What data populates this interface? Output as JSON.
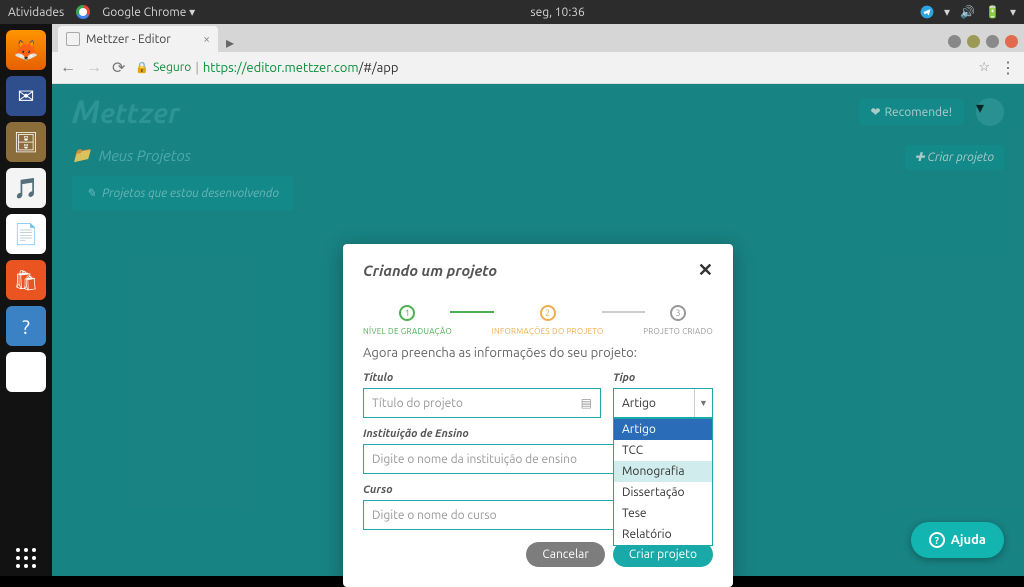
{
  "os_bar": {
    "activities": "Atividades",
    "app_menu": "Google Chrome ▾",
    "clock": "seg, 10:36"
  },
  "browser": {
    "tab_title": "Mettzer - Editor",
    "secure_label": "Seguro",
    "url_host": "https://editor.mettzer.com",
    "url_path": "/#/app"
  },
  "app": {
    "brand": "Mettzer",
    "recommend": "Recomende!",
    "breadcrumb": "Meus Projetos",
    "create_btn": "Criar projeto",
    "sub_tab": "Projetos que estou desenvolvendo",
    "help": "Ajuda"
  },
  "modal": {
    "title": "Criando um projeto",
    "steps": {
      "s1": "NÍVEL DE GRADUAÇÃO",
      "s2": "INFORMAÇÕES DO PROJETO",
      "s3": "PROJETO CRIADO"
    },
    "instruction": "Agora preencha as informações do seu projeto:",
    "fields": {
      "titulo_label": "Título",
      "titulo_ph": "Título do projeto",
      "tipo_label": "Tipo",
      "tipo_value": "Artigo",
      "inst_label": "Instituição de Ensino",
      "inst_ph": "Digite o nome da instituição de ensino",
      "curso_label": "Curso",
      "curso_ph": "Digite o nome do curso"
    },
    "tipo_options": [
      "Artigo",
      "TCC",
      "Monografia",
      "Dissertação",
      "Tese",
      "Relatório"
    ],
    "tipo_selected_index": 0,
    "tipo_hover_index": 2,
    "cancel": "Cancelar",
    "submit": "Criar projeto"
  }
}
